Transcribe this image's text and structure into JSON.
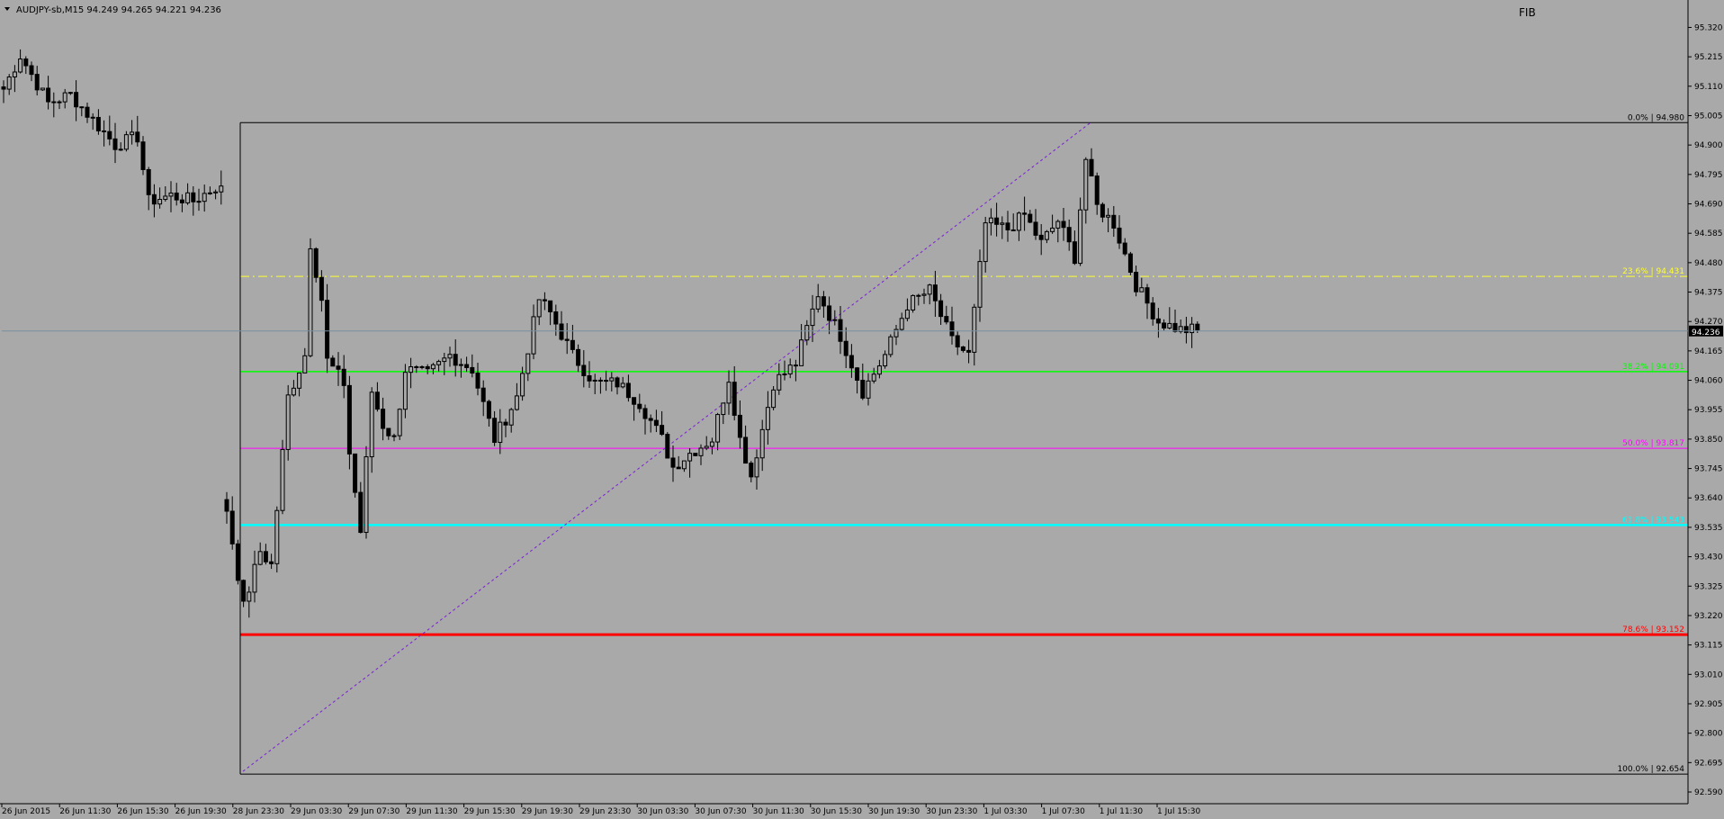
{
  "window": {
    "symbol_line": "AUDJPY-sb,M15  94.249 94.265 94.221 94.236",
    "indicator_label": "FIB"
  },
  "colors": {
    "background": "#a9a9a9",
    "candles": "#000000",
    "fib_0": "#000000",
    "fib_23_6": "#ffff33",
    "fib_38_2": "#00ff00",
    "fib_50": "#ff00ff",
    "fib_61_8": "#00ffff",
    "fib_78_6": "#ff0000",
    "fib_100": "#000000",
    "trendline": "#7a1fd6",
    "current_price_line": "#7890a0",
    "price_tag_bg": "#000000"
  },
  "chart_data": {
    "type": "candlestick",
    "title": "AUDJPY-sb,M15",
    "header_values": {
      "open": 94.249,
      "high": 94.265,
      "low": 94.221,
      "close": 94.236
    },
    "ylim": [
      92.59,
      95.36
    ],
    "y_ticks": [
      "95.320",
      "95.215",
      "95.110",
      "95.005",
      "94.900",
      "94.795",
      "94.690",
      "94.585",
      "94.480",
      "94.375",
      "94.270",
      "94.165",
      "94.060",
      "93.955",
      "93.850",
      "93.745",
      "93.640",
      "93.535",
      "93.430",
      "93.325",
      "93.220",
      "93.115",
      "93.010",
      "92.905",
      "92.800",
      "92.695",
      "92.590"
    ],
    "current_price": "94.236",
    "x_ticks": [
      "26 Jun 2015",
      "26 Jun 11:30",
      "26 Jun 15:30",
      "26 Jun 19:30",
      "28 Jun 23:30",
      "29 Jun 03:30",
      "29 Jun 07:30",
      "29 Jun 11:30",
      "29 Jun 15:30",
      "29 Jun 19:30",
      "29 Jun 23:30",
      "30 Jun 03:30",
      "30 Jun 07:30",
      "30 Jun 11:30",
      "30 Jun 15:30",
      "30 Jun 19:30",
      "30 Jun 23:30",
      "1 Jul 03:30",
      "1 Jul 07:30",
      "1 Jul 11:30",
      "1 Jul 15:30"
    ],
    "fibonacci": [
      {
        "level": "0.0%",
        "price": "94.980",
        "label": "0.0% | 94.980",
        "style": "solid"
      },
      {
        "level": "23.6%",
        "price": "94.431",
        "label": "23.6% | 94.431",
        "style": "dashdot"
      },
      {
        "level": "38.2%",
        "price": "94.091",
        "label": "38.2% | 94.091",
        "style": "solid"
      },
      {
        "level": "50.0%",
        "price": "93.817",
        "label": "50.0% | 93.817",
        "style": "solid"
      },
      {
        "level": "61.8%",
        "price": "93.543",
        "label": "61.8% | 93.543",
        "style": "solid"
      },
      {
        "level": "78.6%",
        "price": "93.152",
        "label": "78.6% | 93.152",
        "style": "solid"
      },
      {
        "level": "100.0%",
        "price": "92.654",
        "label": "100.0% | 92.654",
        "style": "solid"
      }
    ],
    "path_segments": [
      [
        0,
        95.1
      ],
      [
        3,
        95.22
      ],
      [
        8,
        95.05
      ],
      [
        12,
        95.08
      ],
      [
        20,
        94.9
      ],
      [
        24,
        94.93
      ],
      [
        26,
        94.7
      ],
      [
        30,
        94.72
      ],
      [
        34,
        94.7
      ],
      [
        38,
        94.75
      ],
      [
        40,
        94.73
      ],
      [
        40,
        93.6
      ],
      [
        43,
        93.25
      ],
      [
        46,
        93.45
      ],
      [
        48,
        93.4
      ],
      [
        51,
        94.0
      ],
      [
        54,
        94.15
      ],
      [
        55,
        94.55
      ],
      [
        57,
        94.35
      ],
      [
        58,
        94.13
      ],
      [
        61,
        94.05
      ],
      [
        62,
        93.8
      ],
      [
        64,
        93.52
      ],
      [
        66,
        94.02
      ],
      [
        68,
        93.9
      ],
      [
        70,
        93.85
      ],
      [
        72,
        94.1
      ],
      [
        76,
        94.08
      ],
      [
        80,
        94.15
      ],
      [
        84,
        94.1
      ],
      [
        88,
        93.85
      ],
      [
        92,
        94.0
      ],
      [
        96,
        94.35
      ],
      [
        98,
        94.3
      ],
      [
        102,
        94.15
      ],
      [
        106,
        94.05
      ],
      [
        110,
        94.05
      ],
      [
        114,
        93.98
      ],
      [
        118,
        93.85
      ],
      [
        120,
        93.75
      ],
      [
        123,
        93.8
      ],
      [
        127,
        93.85
      ],
      [
        130,
        94.07
      ],
      [
        132,
        93.85
      ],
      [
        134,
        93.72
      ],
      [
        138,
        94.05
      ],
      [
        142,
        94.12
      ],
      [
        146,
        94.37
      ],
      [
        150,
        94.22
      ],
      [
        154,
        94.02
      ],
      [
        158,
        94.15
      ],
      [
        162,
        94.33
      ],
      [
        166,
        94.38
      ],
      [
        170,
        94.2
      ],
      [
        173,
        94.15
      ],
      [
        176,
        94.62
      ],
      [
        180,
        94.6
      ],
      [
        183,
        94.65
      ],
      [
        186,
        94.55
      ],
      [
        189,
        94.63
      ],
      [
        192,
        94.5
      ],
      [
        194,
        94.85
      ],
      [
        196,
        94.68
      ],
      [
        199,
        94.62
      ],
      [
        203,
        94.4
      ],
      [
        207,
        94.27
      ],
      [
        211,
        94.24
      ],
      [
        214,
        94.24
      ]
    ]
  }
}
